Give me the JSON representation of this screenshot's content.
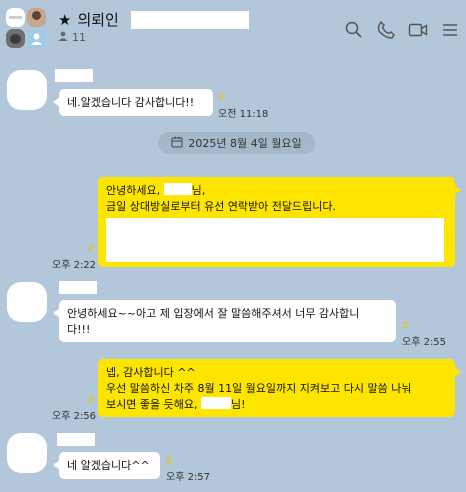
{
  "header": {
    "title": "의뢰인",
    "member_count": "11"
  },
  "date_divider": "2025년 8월 4일 월요일",
  "messages": [
    {
      "text": "네.알겠습니다 감사합니다!!",
      "time": "오전 11:18",
      "unread": "2"
    },
    {
      "line1_a": "안녕하세요,",
      "line1_b": "님,",
      "line2": "금일 상대방실로부터 유선 연락받아 전달드립니다.",
      "time": "오후 2:22",
      "unread": "2"
    },
    {
      "line1": "안녕하세요~~아고 제 입장에서 잘 말씀해주셔서 너무 감사합니",
      "line2": "다!!!",
      "time": "오후 2:55",
      "unread": "2"
    },
    {
      "line1": "넵, 감사합니다 ^^",
      "line2": "우선 말씀하신 차주 8월 11일 월요일까지 지켜보고 다시 말씀 나눠",
      "line3_a": "보시면 좋을 듯해요,",
      "line3_b": "님!",
      "time": "오후 2:56",
      "unread": "2"
    },
    {
      "text": "네 알겠습니다^^",
      "time": "오후 2:57",
      "unread": "2"
    }
  ]
}
